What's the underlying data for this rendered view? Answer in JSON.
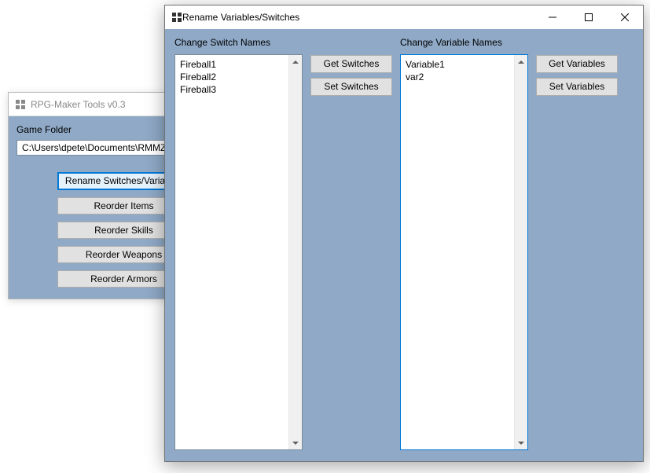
{
  "back_window": {
    "title": "RPG-Maker Tools v0.3",
    "folder_label": "Game Folder",
    "folder_value": "C:\\Users\\dpete\\Documents\\RMMZ",
    "buttons": {
      "rename": "Rename Switches/Variables",
      "items": "Reorder Items",
      "skills": "Reorder Skills",
      "weapons": "Reorder Weapons",
      "armors": "Reorder Armors"
    }
  },
  "front_window": {
    "title": "Rename Variables/Switches",
    "switch_label": "Change Switch Names",
    "variable_label": "Change Variable Names",
    "switch_text": "Fireball1\nFireball2\nFireball3",
    "variable_text": "Variable1\nvar2",
    "buttons": {
      "get_switches": "Get Switches",
      "set_switches": "Set Switches",
      "get_variables": "Get Variables",
      "set_variables": "Set Variables"
    }
  }
}
